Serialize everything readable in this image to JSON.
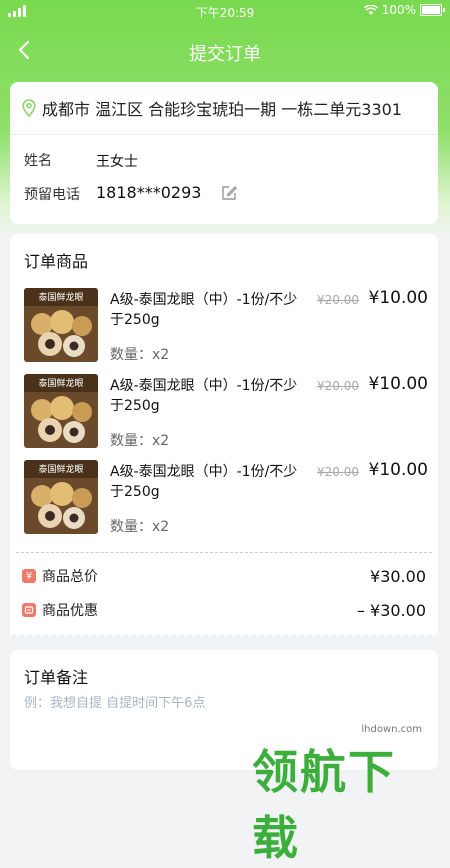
{
  "status": {
    "time": "下午20:59",
    "battery": "100%"
  },
  "nav": {
    "title": "提交订单"
  },
  "address": {
    "text": "成都市 温江区 合能珍宝琥珀一期  一栋二单元3301",
    "name_label": "姓名",
    "name_value": "王女士",
    "phone_label": "预留电话",
    "phone_value": "1818***0293"
  },
  "goods": {
    "title": "订单商品",
    "items": [
      {
        "thumb_text": "泰国鲜龙眼",
        "name": "A级-泰国龙眼（中）-1份/不少于250g",
        "orig_price": "¥20.00",
        "price": "¥10.00",
        "qty": "数量：x2"
      },
      {
        "thumb_text": "泰国鲜龙眼",
        "name": "A级-泰国龙眼（中）-1份/不少于250g",
        "orig_price": "¥20.00",
        "price": "¥10.00",
        "qty": "数量：x2"
      },
      {
        "thumb_text": "泰国鲜龙眼",
        "name": "A级-泰国龙眼（中）-1份/不少于250g",
        "orig_price": "¥20.00",
        "price": "¥10.00",
        "qty": "数量：x2"
      }
    ],
    "total_icon": "¥",
    "total_label": "商品总价",
    "total_value": "¥30.00",
    "discount_label": "商品优惠",
    "discount_value": "– ¥30.00"
  },
  "note": {
    "title": "订单备注",
    "placeholder": "例：我想自提 自提时间下午6点"
  },
  "watermark": {
    "url": "lhdown.com",
    "logo": "领航下载"
  },
  "colors": {
    "brand_green": "#79d94f",
    "icon_red": "#f07a6a",
    "watermark_green": "#3cae3c"
  }
}
